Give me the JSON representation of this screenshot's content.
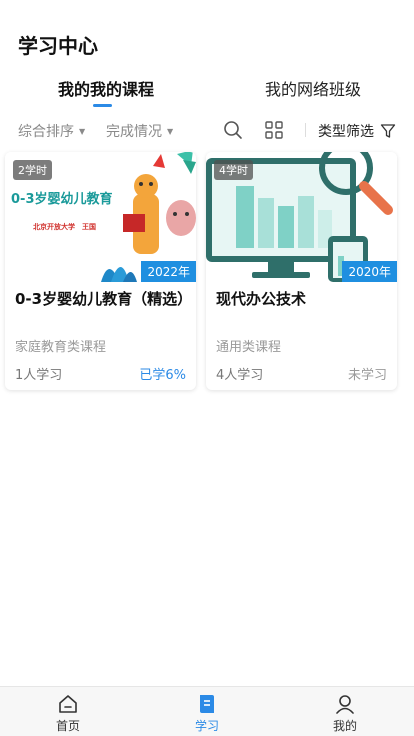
{
  "page": {
    "title": "学习中心"
  },
  "tabs": [
    {
      "label": "我的我的课程",
      "active": true
    },
    {
      "label": "我的网络班级",
      "active": false
    }
  ],
  "filters": {
    "sort": "综合排序",
    "completion": "完成情况",
    "type": "类型筛选"
  },
  "courses": [
    {
      "hours": "2学时",
      "year": "2022年",
      "cover_title": "0-3岁婴幼儿教育",
      "cover_subtitle": "北京开放大学　王国",
      "title": "0-3岁婴幼儿教育（精选）",
      "category": "家庭教育类课程",
      "learners": "1人学习",
      "progress": "已学6%",
      "progress_active": true
    },
    {
      "hours": "4学时",
      "year": "2020年",
      "title": "现代办公技术",
      "category": "通用类课程",
      "learners": "4人学习",
      "progress": "未学习",
      "progress_active": false
    }
  ],
  "bottom_nav": [
    {
      "label": "首页",
      "icon": "home-icon",
      "active": false
    },
    {
      "label": "学习",
      "icon": "book-icon",
      "active": true
    },
    {
      "label": "我的",
      "icon": "user-icon",
      "active": false
    }
  ],
  "colors": {
    "accent": "#2b8ae6",
    "badge_blue": "#1f8fe0"
  }
}
